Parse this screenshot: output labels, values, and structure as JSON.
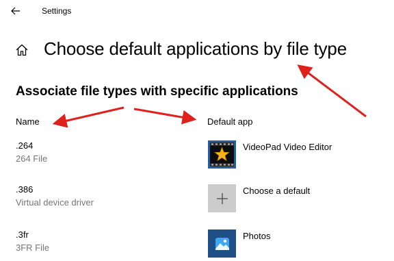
{
  "window": {
    "title": "Settings"
  },
  "header": {
    "page_title": "Choose default applications by file type"
  },
  "section": {
    "title": "Associate file types with specific applications"
  },
  "columns": {
    "name": "Name",
    "default_app": "Default app"
  },
  "rows": [
    {
      "extension": ".264",
      "description": "264 File",
      "app": {
        "name": "VideoPad Video Editor",
        "icon": "videopad-star-icon"
      }
    },
    {
      "extension": ".386",
      "description": "Virtual device driver",
      "app": {
        "name": "Choose a default",
        "icon": "plus-icon"
      }
    },
    {
      "extension": ".3fr",
      "description": "3FR File",
      "app": {
        "name": "Photos",
        "icon": "photos-icon"
      }
    }
  ],
  "colors": {
    "description_text": "#767676",
    "annotation_arrow": "#e0201b",
    "videopad_tile": "#1f5fa8",
    "choose_default_tile": "#cccccc",
    "photos_tile": "#1e4f86"
  }
}
